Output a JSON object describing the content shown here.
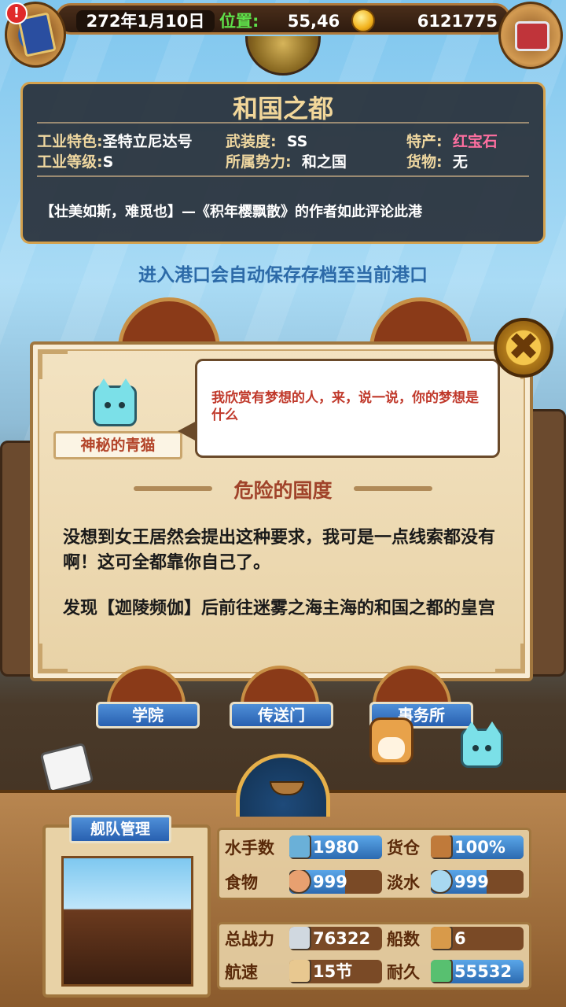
{
  "top_bar": {
    "date": "272年1月10日",
    "position_label": "位置:",
    "position_value": "55,46",
    "gold": "6121775",
    "alert": "!"
  },
  "port": {
    "name": "和国之都",
    "industry_feature_label": "工业特色:",
    "industry_feature_value": "圣特立尼达号",
    "armament_label": "武装度:",
    "armament_value": "SS",
    "specialty_label": "特产:",
    "specialty_value": "红宝石",
    "industry_level_label": "工业等级:",
    "industry_level_value": "S",
    "faction_label": "所属势力:",
    "faction_value": "和之国",
    "goods_label": "货物:",
    "goods_value": "无",
    "quote": "【壮美如斯，难觅也】—《积年樱飘散》的作者如此评论此港"
  },
  "autosave_notice": "进入港口会自动保存存档至当前港口",
  "dialog": {
    "npc_name": "神秘的青猫",
    "speech": "我欣赏有梦想的人，来，说一说，你的梦想是什么",
    "quest_title": "危险的国度",
    "paragraph1": "没想到女王居然会提出这种要求，我可是一点线索都没有啊！这可全都靠你自己了。",
    "paragraph2": "发现【迦陵频伽】后前往迷雾之海主海的和国之都的皇宫",
    "close_symbol": "✖"
  },
  "facilities": [
    {
      "label": "学院"
    },
    {
      "label": "传送门"
    },
    {
      "label": "事务所"
    }
  ],
  "fleet": {
    "title": "舰队管理",
    "stats": {
      "sailors": {
        "label": "水手数",
        "value": "1980",
        "fill": 1.0
      },
      "cargo": {
        "label": "货仓",
        "value": "100%",
        "fill": 1.0
      },
      "food": {
        "label": "食物",
        "value": "999",
        "fill": 0.6
      },
      "water": {
        "label": "淡水",
        "value": "999",
        "fill": 0.6
      },
      "power": {
        "label": "总战力",
        "value": "76322",
        "fill": 0.0
      },
      "ships": {
        "label": "船数",
        "value": "6",
        "fill": 0.0
      },
      "speed": {
        "label": "航速",
        "value": "15节",
        "fill": 0.0
      },
      "durability": {
        "label": "耐久",
        "value": "55532",
        "fill": 1.0
      }
    }
  },
  "colors": {
    "accent_blue": "#2860b0",
    "gold_text": "#f2d79a",
    "specialty_pink": "#ff6fa0",
    "position_green": "#5ee04a"
  }
}
